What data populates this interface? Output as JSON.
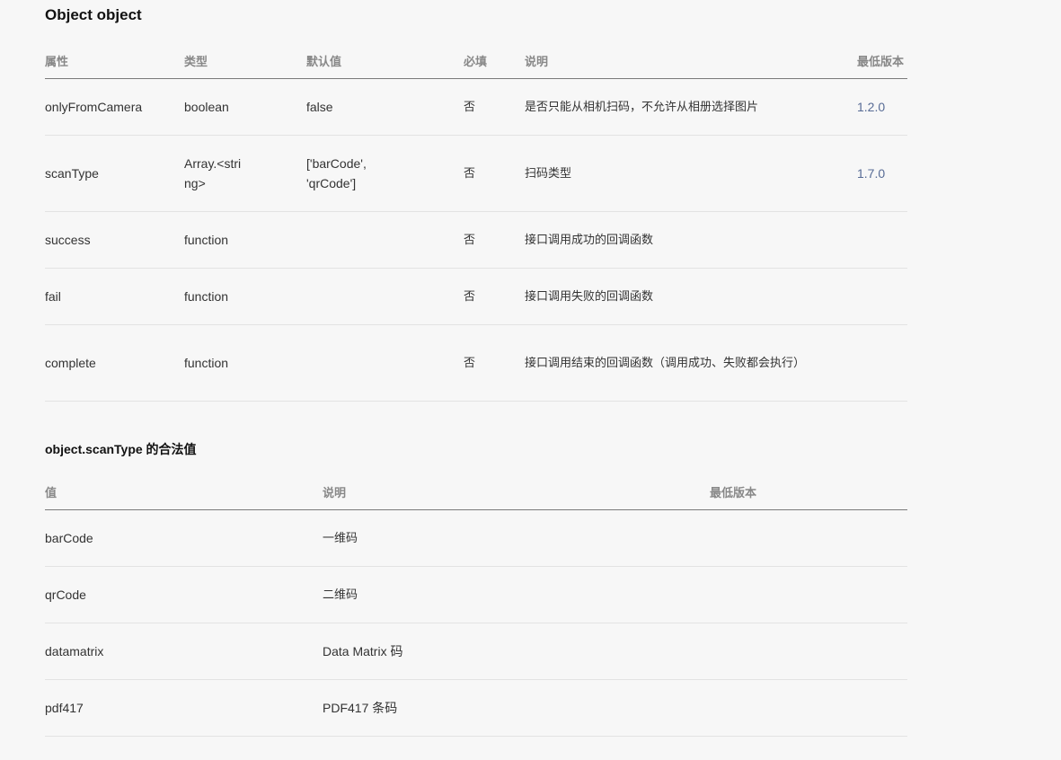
{
  "section1": {
    "title": "Object object",
    "headers": [
      "属性",
      "类型",
      "默认值",
      "必填",
      "说明",
      "最低版本"
    ],
    "rows": [
      {
        "name": "onlyFromCamera",
        "type": "boolean",
        "default": "false",
        "required": "否",
        "desc": "是否只能从相机扫码，不允许从相册选择图片",
        "version": "1.2.0"
      },
      {
        "name": "scanType",
        "type": "Array.<string>",
        "default": "['barCode', 'qrCode']",
        "required": "否",
        "desc": "扫码类型",
        "version": "1.7.0"
      },
      {
        "name": "success",
        "type": "function",
        "default": "",
        "required": "否",
        "desc": "接口调用成功的回调函数",
        "version": ""
      },
      {
        "name": "fail",
        "type": "function",
        "default": "",
        "required": "否",
        "desc": "接口调用失败的回调函数",
        "version": ""
      },
      {
        "name": "complete",
        "type": "function",
        "default": "",
        "required": "否",
        "desc": "接口调用结束的回调函数（调用成功、失败都会执行）",
        "version": ""
      }
    ]
  },
  "section2": {
    "title": "object.scanType 的合法值",
    "headers": [
      "值",
      "说明",
      "最低版本"
    ],
    "rows": [
      {
        "value": "barCode",
        "desc": "一维码",
        "version": ""
      },
      {
        "value": "qrCode",
        "desc": "二维码",
        "version": ""
      },
      {
        "value": "datamatrix",
        "desc": "Data Matrix 码",
        "version": ""
      },
      {
        "value": "pdf417",
        "desc": "PDF417 条码",
        "version": ""
      }
    ]
  }
}
